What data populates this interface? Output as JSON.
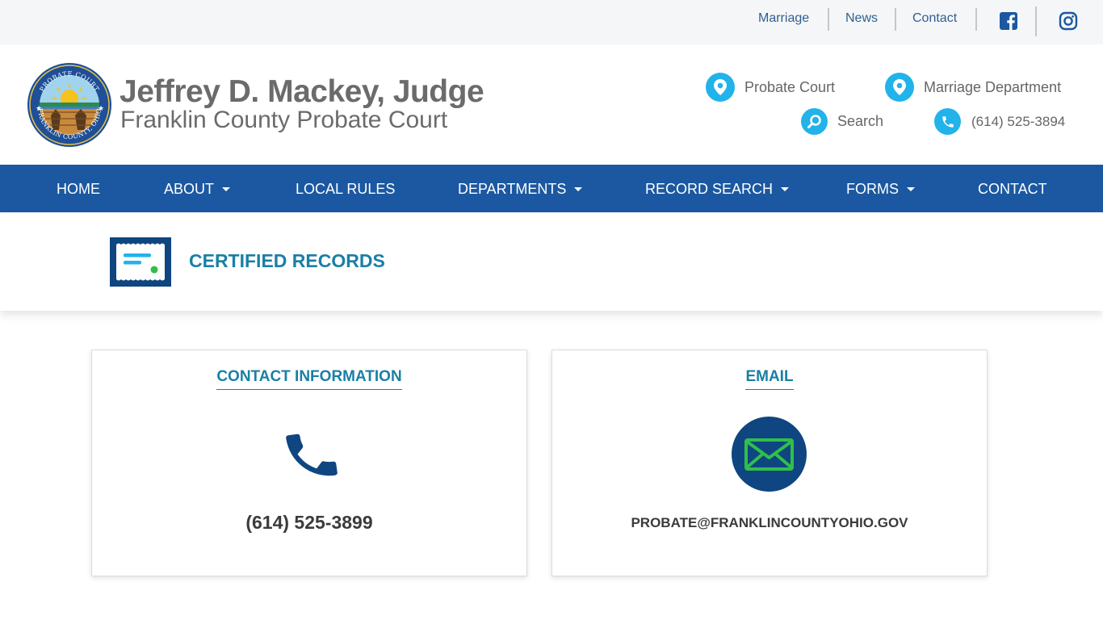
{
  "topbar": {
    "links": [
      "Marriage",
      "News",
      "Contact"
    ],
    "social": [
      "facebook-icon",
      "instagram-icon"
    ]
  },
  "header": {
    "judge_name": "Jeffrey D. Mackey, Judge",
    "court_name": "Franklin County Probate Court",
    "seal_text": "PROBATE COURT · FRANKLIN COUNTY, OHIO",
    "quick_links": [
      {
        "label": "Probate Court",
        "icon": "map-pin-icon"
      },
      {
        "label": "Marriage Department",
        "icon": "map-pin-icon"
      },
      {
        "label": "Search",
        "icon": "search-icon"
      },
      {
        "label": "(614) 525-3894",
        "icon": "phone-icon"
      }
    ]
  },
  "nav": {
    "items": [
      {
        "label": "HOME",
        "dropdown": false
      },
      {
        "label": "ABOUT",
        "dropdown": true
      },
      {
        "label": "LOCAL RULES",
        "dropdown": false
      },
      {
        "label": "DEPARTMENTS",
        "dropdown": true
      },
      {
        "label": "RECORD SEARCH",
        "dropdown": true
      },
      {
        "label": "FORMS",
        "dropdown": true
      },
      {
        "label": "CONTACT",
        "dropdown": false
      }
    ]
  },
  "page": {
    "title": "CERTIFIED RECORDS",
    "icon": "certificate-icon"
  },
  "cards": {
    "contact": {
      "title": "CONTACT INFORMATION",
      "value": "(614) 525-3899",
      "icon": "phone-icon"
    },
    "email": {
      "title": "EMAIL",
      "value": "PROBATE@FRANKLINCOUNTYOHIO.GOV",
      "icon": "envelope-icon"
    }
  },
  "colors": {
    "nav_bg": "#1b58a1",
    "accent_teal": "#1a7fa6",
    "icon_cyan": "#21b3ea",
    "dark_navy": "#0f4580",
    "email_green": "#2fbf4a"
  }
}
